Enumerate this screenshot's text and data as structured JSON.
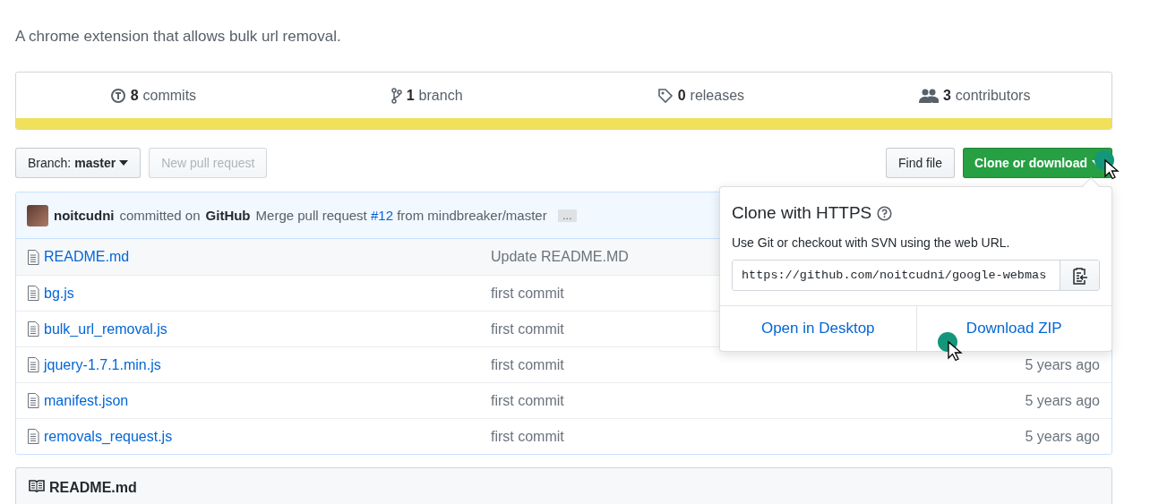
{
  "description": "A chrome extension that allows bulk url removal.",
  "stats": [
    {
      "kind": "commits",
      "count": "8",
      "label": "commits"
    },
    {
      "kind": "branch",
      "count": "1",
      "label": "branch"
    },
    {
      "kind": "releases",
      "count": "0",
      "label": "releases"
    },
    {
      "kind": "contributors",
      "count": "3",
      "label": "contributors"
    }
  ],
  "branch_button": {
    "label": "Branch:",
    "value": "master"
  },
  "new_pull_request": {
    "label": "New pull request",
    "disabled": true
  },
  "find_file": "Find file",
  "clone_button": {
    "label": "Clone or download",
    "expanded": true
  },
  "commit": {
    "author": "noitcudni",
    "action": "committed on",
    "platform": "GitHub",
    "message_start": "Merge pull request",
    "link": "#12",
    "message_end": "from mindbreaker/master",
    "more": "…"
  },
  "files": [
    {
      "name": "README.md",
      "message": "Update README.MD"
    },
    {
      "name": "bg.js",
      "message": "first commit"
    },
    {
      "name": "bulk_url_removal.js",
      "message": "first commit"
    },
    {
      "name": "jquery-1.7.1.min.js",
      "message": "first commit",
      "age": "5 years ago"
    },
    {
      "name": "manifest.json",
      "message": "first commit",
      "age": "5 years ago"
    },
    {
      "name": "removals_request.js",
      "message": "first commit",
      "age": "5 years ago"
    }
  ],
  "readme": {
    "title": "README.md"
  },
  "clone_panel": {
    "title": "Clone with HTTPS",
    "subtitle": "Use Git or checkout with SVN using the web URL.",
    "url": "https://github.com/noitcudni/google-webmas",
    "actions": [
      "Open in Desktop",
      "Download ZIP"
    ]
  }
}
